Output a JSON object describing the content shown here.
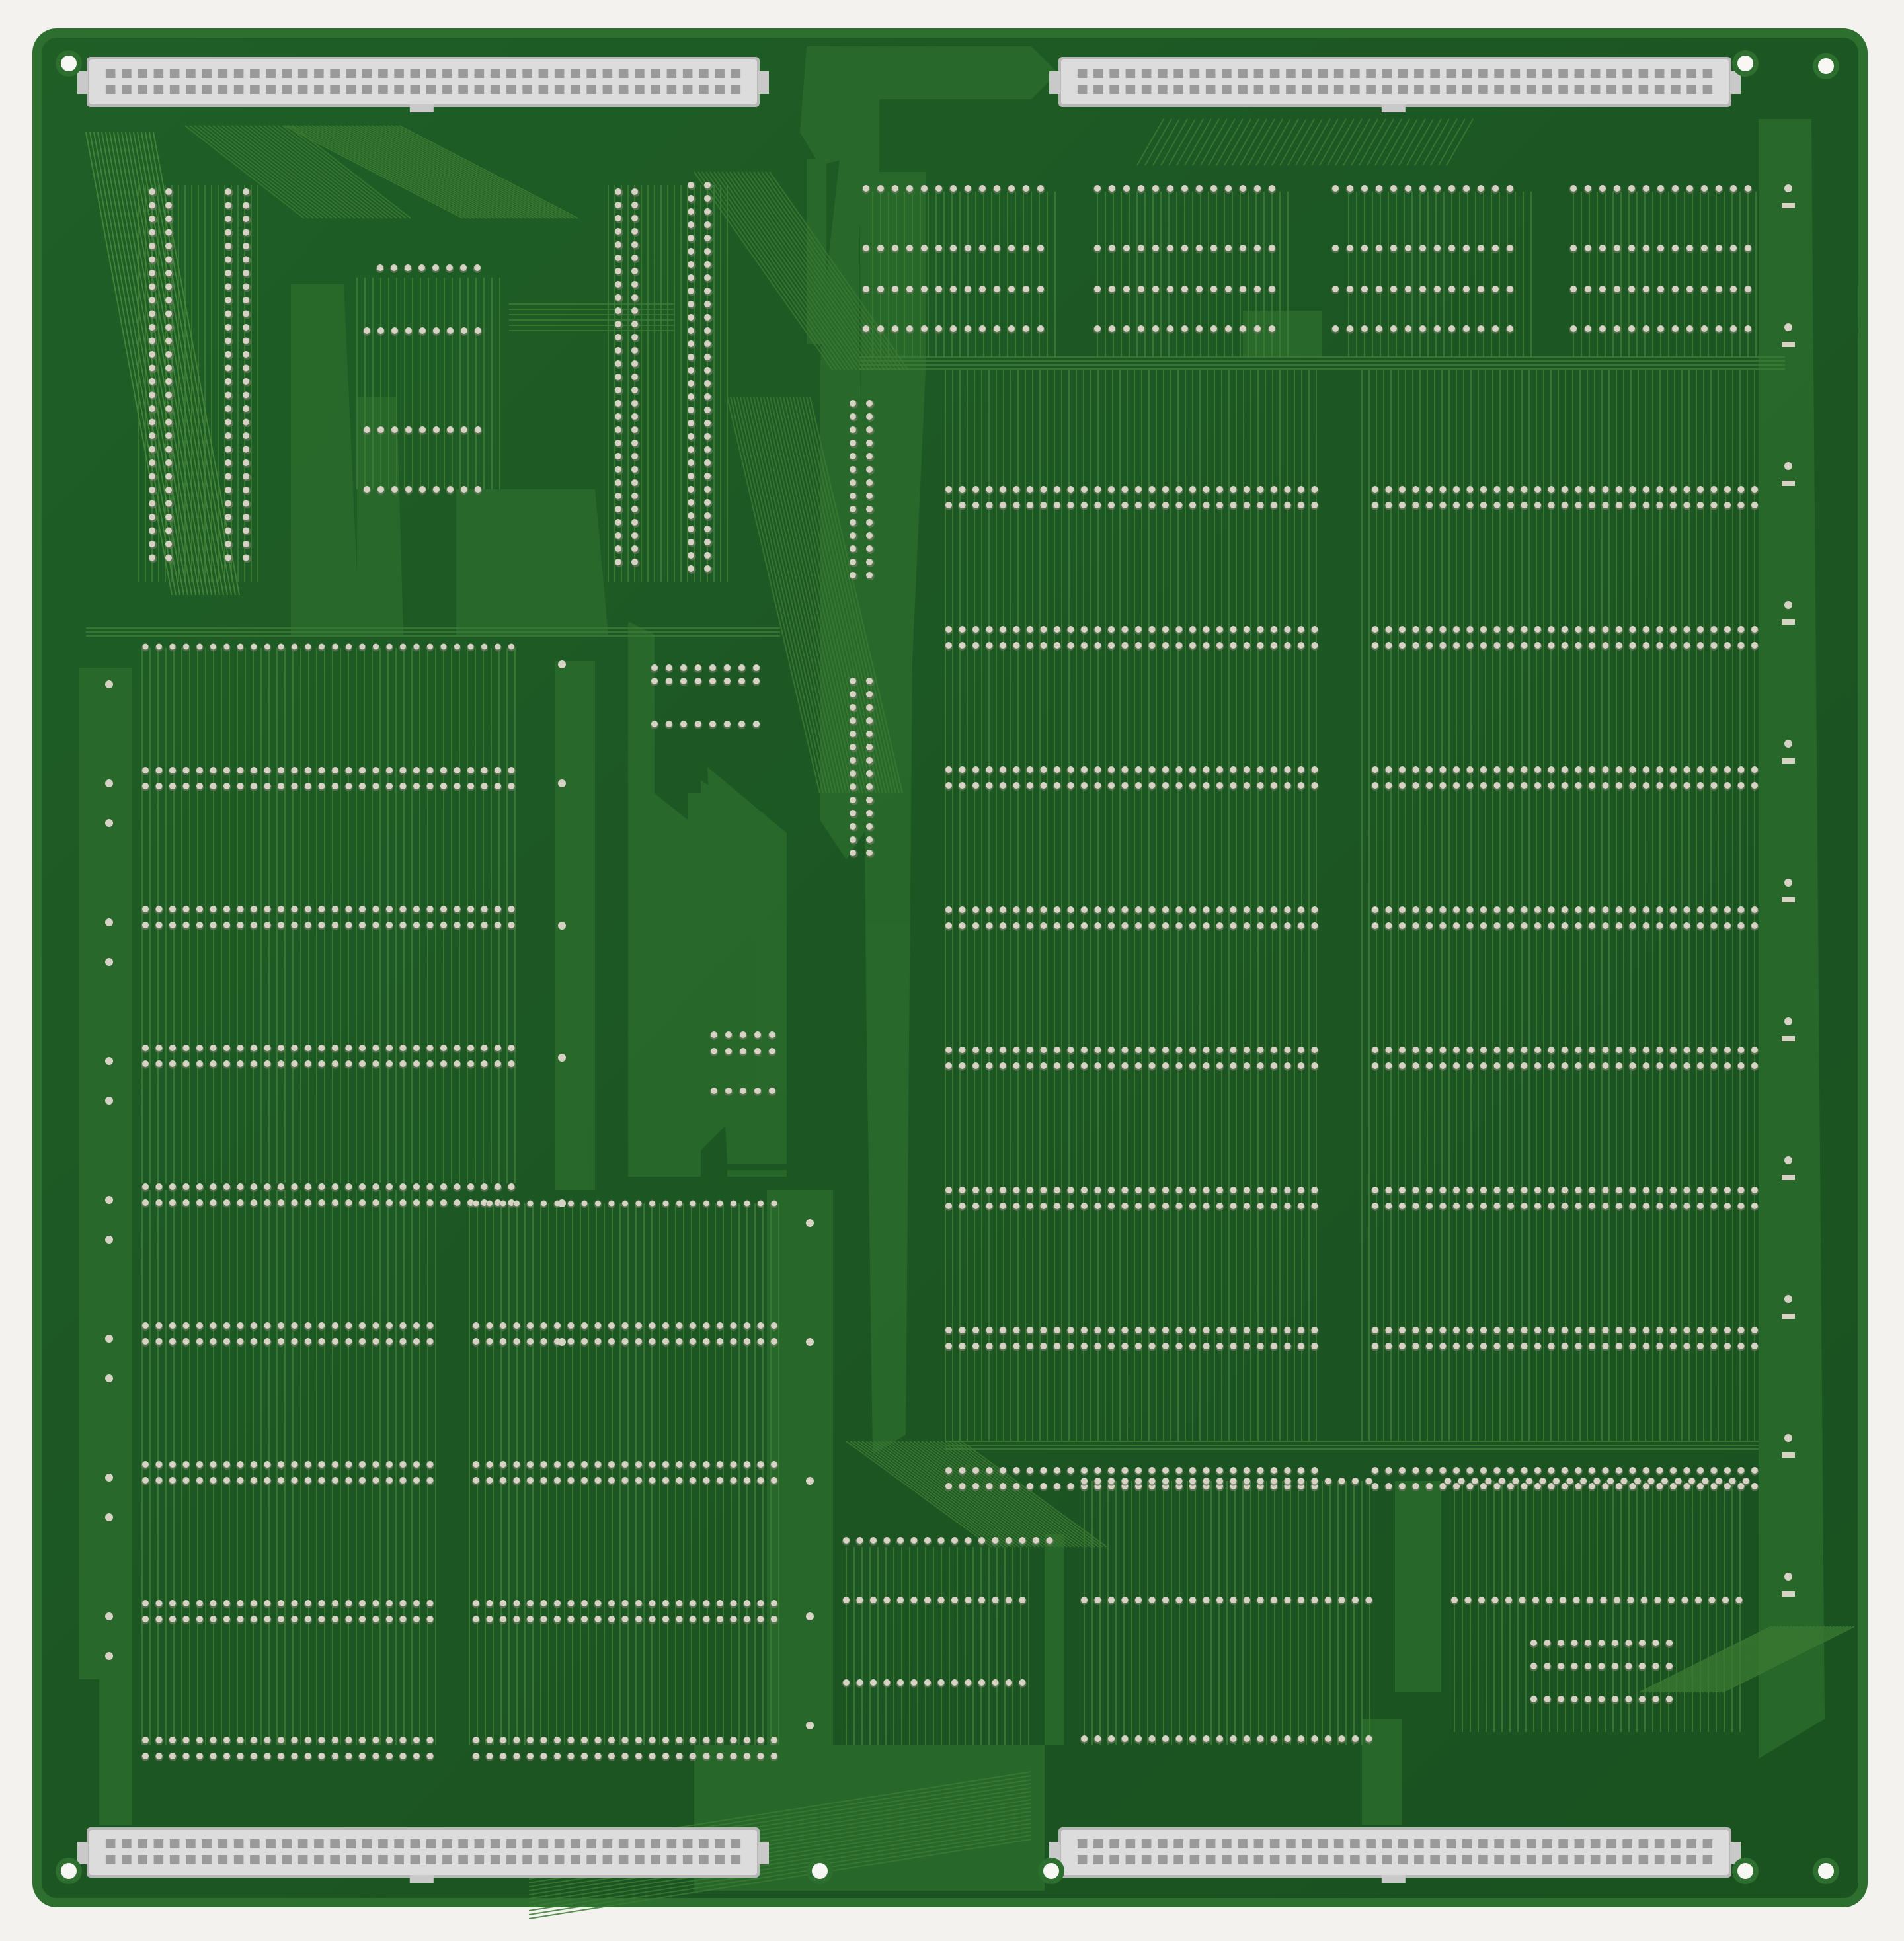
{
  "image": {
    "subject": "pcb-back-side",
    "text_labels": []
  },
  "colors": {
    "background": "#f4f2ee",
    "board": "#1d5a24",
    "board_dark": "#174a1d",
    "copper_pour": "#2a6b2c",
    "trace": "#3b7a33",
    "trace_light": "#4a8a3c",
    "pad": "#d6d2c4",
    "pad_shadow": "#6f7a62",
    "connector_body": "#dcdcdc",
    "connector_slot": "#9a9a9a",
    "mount_hole": "#f7f7f3"
  },
  "connectors": [
    {
      "id": "J1",
      "position": "top-left",
      "pins_per_row": 40,
      "rows": 2
    },
    {
      "id": "J2",
      "position": "top-right",
      "pins_per_row": 40,
      "rows": 2
    },
    {
      "id": "J3",
      "position": "bottom-left",
      "pins_per_row": 40,
      "rows": 2
    },
    {
      "id": "J4",
      "position": "bottom-right",
      "pins_per_row": 40,
      "rows": 2
    }
  ],
  "mounting_holes": 8,
  "chip_footprint_rows": {
    "upper_dip_sets": 4,
    "left_memory_rows": 8,
    "right_memory_rows": 8
  }
}
